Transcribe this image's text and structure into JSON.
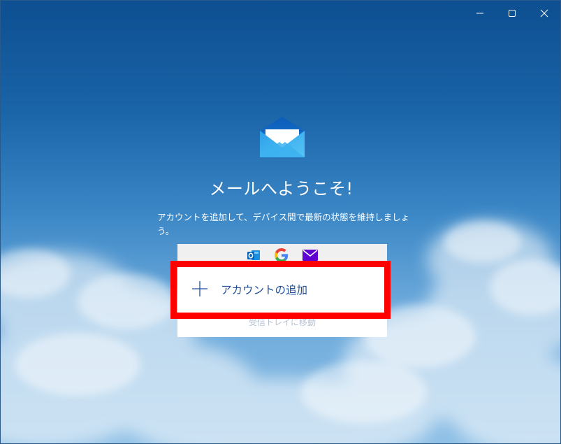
{
  "window": {
    "controls": {
      "minimize": "minimize-icon",
      "maximize": "maximize-icon",
      "close": "close-icon"
    }
  },
  "welcome": {
    "title": "メールへようこそ!",
    "description": "アカウントを追加して、デバイス間で最新の状態を維持しましょう。"
  },
  "providers": [
    "outlook-icon",
    "google-icon",
    "yahoo-mail-icon"
  ],
  "actions": {
    "add_account": "アカウントの追加",
    "go_to_inbox": "受信トレイに移動"
  },
  "colors": {
    "accent": "#1f4f9a",
    "highlight": "#ff0000"
  }
}
